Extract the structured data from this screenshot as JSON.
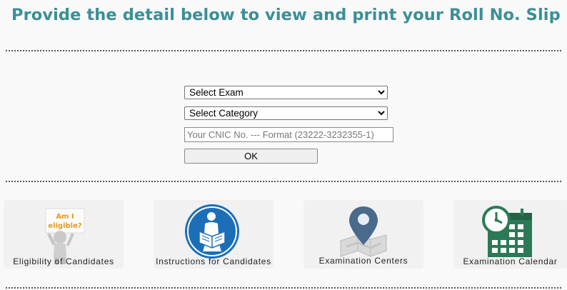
{
  "page": {
    "title": "Provide the detail below to view and print your Roll No. Slip"
  },
  "form": {
    "exam_select": {
      "selected": "Select Exam",
      "options": [
        "Select Exam"
      ]
    },
    "category_select": {
      "selected": "Select Category",
      "options": [
        "Select Category"
      ]
    },
    "cnic_input": {
      "value": "",
      "placeholder": "Your CNIC No. --- Format (23222-3232355-1)"
    },
    "ok_label": "OK"
  },
  "cards": [
    {
      "label": "Eligibility of Candidates",
      "icon": "eligibility-figure-icon",
      "sign_line1": "Am I",
      "sign_line2": "eligible?"
    },
    {
      "label": "Instructions for Candidates",
      "icon": "person-reading-icon"
    },
    {
      "label": "Examination Centers",
      "icon": "map-pin-icon"
    },
    {
      "label": "Examination Calendar",
      "icon": "calendar-clock-icon"
    }
  ],
  "colors": {
    "title": "#3a8f97",
    "instructions_circle": "#1c6fb7",
    "calendar_green": "#2b7a55",
    "eligibility_sign": "#e79a22",
    "map_pin": "#4a6a8c"
  }
}
